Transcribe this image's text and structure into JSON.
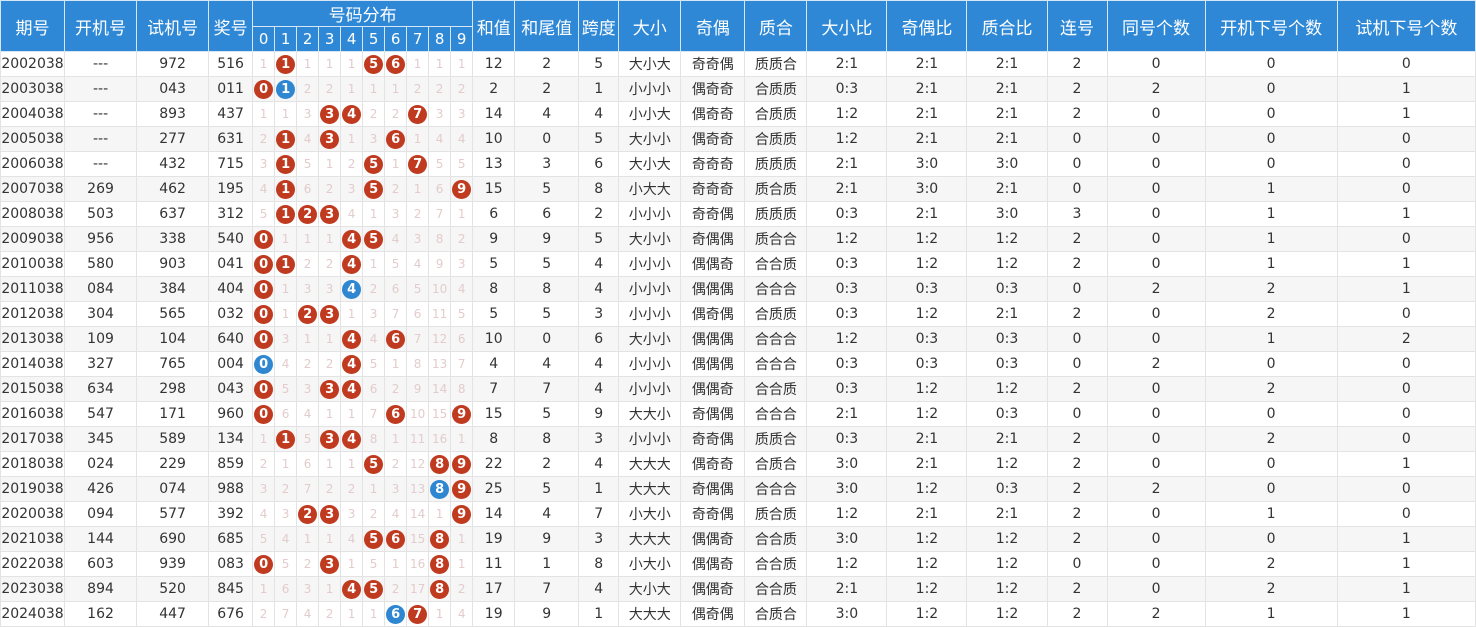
{
  "headers": {
    "period": "期号",
    "open_no": "开机号",
    "test_no": "试机号",
    "prize_no": "奖号",
    "distribution": "号码分布",
    "digits": [
      "0",
      "1",
      "2",
      "3",
      "4",
      "5",
      "6",
      "7",
      "8",
      "9"
    ],
    "sum": "和值",
    "sum_tail": "和尾值",
    "span": "跨度",
    "size": "大小",
    "parity": "奇偶",
    "prime": "质合",
    "size_ratio": "大小比",
    "parity_ratio": "奇偶比",
    "prime_ratio": "质合比",
    "consec": "连号",
    "same_cnt": "同号个数",
    "open_down_cnt": "开机下号个数",
    "test_down_cnt": "试机下号个数"
  },
  "colors": {
    "header_bg": "#2e88d6",
    "ball_red": "#bf3a1f",
    "ball_blue": "#2f87d1",
    "omit_text": "#e3cccc"
  },
  "rows": [
    {
      "period": "2002038",
      "open": "---",
      "test": "972",
      "prize": "516",
      "dist": [
        "1",
        "1",
        "1",
        "1",
        "1",
        "5",
        "6",
        "1",
        "1",
        "1"
      ],
      "balls": {
        "1": "r",
        "5": "r",
        "6": "r"
      },
      "sum": "12",
      "tail": "2",
      "span": "5",
      "size": "大小大",
      "parity": "奇奇偶",
      "prime": "质质合",
      "sr": "2:1",
      "pr": "2:1",
      "qr": "2:1",
      "consec": "2",
      "same": "0",
      "od": "0",
      "td": "0"
    },
    {
      "period": "2003038",
      "open": "---",
      "test": "043",
      "prize": "011",
      "dist": [
        "0",
        "1",
        "2",
        "2",
        "1",
        "1",
        "1",
        "2",
        "2",
        "2"
      ],
      "balls": {
        "0": "r",
        "1": "b"
      },
      "sum": "2",
      "tail": "2",
      "span": "1",
      "size": "小小小",
      "parity": "偶奇奇",
      "prime": "合质质",
      "sr": "0:3",
      "pr": "2:1",
      "qr": "2:1",
      "consec": "2",
      "same": "2",
      "od": "0",
      "td": "1"
    },
    {
      "period": "2004038",
      "open": "---",
      "test": "893",
      "prize": "437",
      "dist": [
        "1",
        "1",
        "3",
        "3",
        "4",
        "2",
        "2",
        "7",
        "3",
        "3"
      ],
      "balls": {
        "3": "r",
        "4": "r",
        "7": "r"
      },
      "sum": "14",
      "tail": "4",
      "span": "4",
      "size": "小小大",
      "parity": "偶奇奇",
      "prime": "合质质",
      "sr": "1:2",
      "pr": "2:1",
      "qr": "2:1",
      "consec": "2",
      "same": "0",
      "od": "0",
      "td": "1"
    },
    {
      "period": "2005038",
      "open": "---",
      "test": "277",
      "prize": "631",
      "dist": [
        "2",
        "1",
        "4",
        "3",
        "1",
        "3",
        "6",
        "1",
        "4",
        "4"
      ],
      "balls": {
        "1": "r",
        "3": "r",
        "6": "r"
      },
      "sum": "10",
      "tail": "0",
      "span": "5",
      "size": "大小小",
      "parity": "偶奇奇",
      "prime": "合质质",
      "sr": "1:2",
      "pr": "2:1",
      "qr": "2:1",
      "consec": "0",
      "same": "0",
      "od": "0",
      "td": "0"
    },
    {
      "period": "2006038",
      "open": "---",
      "test": "432",
      "prize": "715",
      "dist": [
        "3",
        "1",
        "5",
        "1",
        "2",
        "5",
        "1",
        "7",
        "5",
        "5"
      ],
      "balls": {
        "1": "r",
        "5": "r",
        "7": "r"
      },
      "sum": "13",
      "tail": "3",
      "span": "6",
      "size": "大小大",
      "parity": "奇奇奇",
      "prime": "质质质",
      "sr": "2:1",
      "pr": "3:0",
      "qr": "3:0",
      "consec": "0",
      "same": "0",
      "od": "0",
      "td": "0"
    },
    {
      "period": "2007038",
      "open": "269",
      "test": "462",
      "prize": "195",
      "dist": [
        "4",
        "1",
        "6",
        "2",
        "3",
        "5",
        "2",
        "1",
        "6",
        "9"
      ],
      "balls": {
        "1": "r",
        "5": "r",
        "9": "r"
      },
      "sum": "15",
      "tail": "5",
      "span": "8",
      "size": "小大大",
      "parity": "奇奇奇",
      "prime": "质合质",
      "sr": "2:1",
      "pr": "3:0",
      "qr": "2:1",
      "consec": "0",
      "same": "0",
      "od": "1",
      "td": "0"
    },
    {
      "period": "2008038",
      "open": "503",
      "test": "637",
      "prize": "312",
      "dist": [
        "5",
        "1",
        "2",
        "3",
        "4",
        "1",
        "3",
        "2",
        "7",
        "1"
      ],
      "balls": {
        "1": "r",
        "2": "r",
        "3": "r"
      },
      "sum": "6",
      "tail": "6",
      "span": "2",
      "size": "小小小",
      "parity": "奇奇偶",
      "prime": "质质质",
      "sr": "0:3",
      "pr": "2:1",
      "qr": "3:0",
      "consec": "3",
      "same": "0",
      "od": "1",
      "td": "1"
    },
    {
      "period": "2009038",
      "open": "956",
      "test": "338",
      "prize": "540",
      "dist": [
        "0",
        "1",
        "1",
        "1",
        "4",
        "5",
        "4",
        "3",
        "8",
        "2"
      ],
      "balls": {
        "0": "r",
        "4": "r",
        "5": "r"
      },
      "sum": "9",
      "tail": "9",
      "span": "5",
      "size": "大小小",
      "parity": "奇偶偶",
      "prime": "质合合",
      "sr": "1:2",
      "pr": "1:2",
      "qr": "1:2",
      "consec": "2",
      "same": "0",
      "od": "1",
      "td": "0"
    },
    {
      "period": "2010038",
      "open": "580",
      "test": "903",
      "prize": "041",
      "dist": [
        "0",
        "1",
        "2",
        "2",
        "4",
        "1",
        "5",
        "4",
        "9",
        "3"
      ],
      "balls": {
        "0": "r",
        "1": "r",
        "4": "r"
      },
      "sum": "5",
      "tail": "5",
      "span": "4",
      "size": "小小小",
      "parity": "偶偶奇",
      "prime": "合合质",
      "sr": "0:3",
      "pr": "1:2",
      "qr": "1:2",
      "consec": "2",
      "same": "0",
      "od": "1",
      "td": "1"
    },
    {
      "period": "2011038",
      "open": "084",
      "test": "384",
      "prize": "404",
      "dist": [
        "0",
        "1",
        "3",
        "3",
        "4",
        "2",
        "6",
        "5",
        "10",
        "4"
      ],
      "balls": {
        "0": "r",
        "4": "b"
      },
      "sum": "8",
      "tail": "8",
      "span": "4",
      "size": "小小小",
      "parity": "偶偶偶",
      "prime": "合合合",
      "sr": "0:3",
      "pr": "0:3",
      "qr": "0:3",
      "consec": "0",
      "same": "2",
      "od": "2",
      "td": "1"
    },
    {
      "period": "2012038",
      "open": "304",
      "test": "565",
      "prize": "032",
      "dist": [
        "0",
        "1",
        "2",
        "3",
        "1",
        "3",
        "7",
        "6",
        "11",
        "5"
      ],
      "balls": {
        "0": "r",
        "2": "r",
        "3": "r"
      },
      "sum": "5",
      "tail": "5",
      "span": "3",
      "size": "小小小",
      "parity": "偶奇偶",
      "prime": "合质质",
      "sr": "0:3",
      "pr": "1:2",
      "qr": "2:1",
      "consec": "2",
      "same": "0",
      "od": "2",
      "td": "0"
    },
    {
      "period": "2013038",
      "open": "109",
      "test": "104",
      "prize": "640",
      "dist": [
        "0",
        "3",
        "1",
        "1",
        "4",
        "4",
        "6",
        "7",
        "12",
        "6"
      ],
      "balls": {
        "0": "r",
        "4": "r",
        "6": "r"
      },
      "sum": "10",
      "tail": "0",
      "span": "6",
      "size": "大小小",
      "parity": "偶偶偶",
      "prime": "合合合",
      "sr": "1:2",
      "pr": "0:3",
      "qr": "0:3",
      "consec": "0",
      "same": "0",
      "od": "1",
      "td": "2"
    },
    {
      "period": "2014038",
      "open": "327",
      "test": "765",
      "prize": "004",
      "dist": [
        "0",
        "4",
        "2",
        "2",
        "4",
        "5",
        "1",
        "8",
        "13",
        "7"
      ],
      "balls": {
        "0": "b",
        "4": "r"
      },
      "sum": "4",
      "tail": "4",
      "span": "4",
      "size": "小小小",
      "parity": "偶偶偶",
      "prime": "合合合",
      "sr": "0:3",
      "pr": "0:3",
      "qr": "0:3",
      "consec": "0",
      "same": "2",
      "od": "0",
      "td": "0"
    },
    {
      "period": "2015038",
      "open": "634",
      "test": "298",
      "prize": "043",
      "dist": [
        "0",
        "5",
        "3",
        "3",
        "4",
        "6",
        "2",
        "9",
        "14",
        "8"
      ],
      "balls": {
        "0": "r",
        "3": "r",
        "4": "r"
      },
      "sum": "7",
      "tail": "7",
      "span": "4",
      "size": "小小小",
      "parity": "偶偶奇",
      "prime": "合合质",
      "sr": "0:3",
      "pr": "1:2",
      "qr": "1:2",
      "consec": "2",
      "same": "0",
      "od": "2",
      "td": "0"
    },
    {
      "period": "2016038",
      "open": "547",
      "test": "171",
      "prize": "960",
      "dist": [
        "0",
        "6",
        "4",
        "1",
        "1",
        "7",
        "6",
        "10",
        "15",
        "9"
      ],
      "balls": {
        "0": "r",
        "6": "r",
        "9": "r"
      },
      "sum": "15",
      "tail": "5",
      "span": "9",
      "size": "大大小",
      "parity": "奇偶偶",
      "prime": "合合合",
      "sr": "2:1",
      "pr": "1:2",
      "qr": "0:3",
      "consec": "0",
      "same": "0",
      "od": "0",
      "td": "0"
    },
    {
      "period": "2017038",
      "open": "345",
      "test": "589",
      "prize": "134",
      "dist": [
        "1",
        "1",
        "5",
        "3",
        "4",
        "8",
        "1",
        "11",
        "16",
        "1"
      ],
      "balls": {
        "1": "r",
        "3": "r",
        "4": "r"
      },
      "sum": "8",
      "tail": "8",
      "span": "3",
      "size": "小小小",
      "parity": "奇奇偶",
      "prime": "质质合",
      "sr": "0:3",
      "pr": "2:1",
      "qr": "2:1",
      "consec": "2",
      "same": "0",
      "od": "2",
      "td": "0"
    },
    {
      "period": "2018038",
      "open": "024",
      "test": "229",
      "prize": "859",
      "dist": [
        "2",
        "1",
        "6",
        "1",
        "1",
        "5",
        "2",
        "12",
        "8",
        "9"
      ],
      "balls": {
        "5": "r",
        "8": "r",
        "9": "r"
      },
      "sum": "22",
      "tail": "2",
      "span": "4",
      "size": "大大大",
      "parity": "偶奇奇",
      "prime": "合质合",
      "sr": "3:0",
      "pr": "2:1",
      "qr": "1:2",
      "consec": "2",
      "same": "0",
      "od": "0",
      "td": "1"
    },
    {
      "period": "2019038",
      "open": "426",
      "test": "074",
      "prize": "988",
      "dist": [
        "3",
        "2",
        "7",
        "2",
        "2",
        "1",
        "3",
        "13",
        "8",
        "9"
      ],
      "balls": {
        "8": "b",
        "9": "r"
      },
      "sum": "25",
      "tail": "5",
      "span": "1",
      "size": "大大大",
      "parity": "奇偶偶",
      "prime": "合合合",
      "sr": "3:0",
      "pr": "1:2",
      "qr": "0:3",
      "consec": "2",
      "same": "2",
      "od": "0",
      "td": "0"
    },
    {
      "period": "2020038",
      "open": "094",
      "test": "577",
      "prize": "392",
      "dist": [
        "4",
        "3",
        "2",
        "3",
        "3",
        "2",
        "4",
        "14",
        "1",
        "9"
      ],
      "balls": {
        "2": "r",
        "3": "r",
        "9": "r"
      },
      "sum": "14",
      "tail": "4",
      "span": "7",
      "size": "小大小",
      "parity": "奇奇偶",
      "prime": "质合质",
      "sr": "1:2",
      "pr": "2:1",
      "qr": "2:1",
      "consec": "2",
      "same": "0",
      "od": "1",
      "td": "0"
    },
    {
      "period": "2021038",
      "open": "144",
      "test": "690",
      "prize": "685",
      "dist": [
        "5",
        "4",
        "1",
        "1",
        "4",
        "5",
        "6",
        "15",
        "8",
        "1"
      ],
      "balls": {
        "5": "r",
        "6": "r",
        "8": "r"
      },
      "sum": "19",
      "tail": "9",
      "span": "3",
      "size": "大大大",
      "parity": "偶偶奇",
      "prime": "合合质",
      "sr": "3:0",
      "pr": "1:2",
      "qr": "1:2",
      "consec": "2",
      "same": "0",
      "od": "0",
      "td": "1"
    },
    {
      "period": "2022038",
      "open": "603",
      "test": "939",
      "prize": "083",
      "dist": [
        "0",
        "5",
        "2",
        "3",
        "1",
        "5",
        "1",
        "16",
        "8",
        "1"
      ],
      "balls": {
        "0": "r",
        "3": "r",
        "8": "r"
      },
      "sum": "11",
      "tail": "1",
      "span": "8",
      "size": "小大小",
      "parity": "偶偶奇",
      "prime": "合合质",
      "sr": "1:2",
      "pr": "1:2",
      "qr": "1:2",
      "consec": "0",
      "same": "0",
      "od": "2",
      "td": "1"
    },
    {
      "period": "2023038",
      "open": "894",
      "test": "520",
      "prize": "845",
      "dist": [
        "1",
        "6",
        "3",
        "1",
        "4",
        "5",
        "2",
        "17",
        "8",
        "2"
      ],
      "balls": {
        "4": "r",
        "5": "r",
        "8": "r"
      },
      "sum": "17",
      "tail": "7",
      "span": "4",
      "size": "大小大",
      "parity": "偶偶奇",
      "prime": "合合质",
      "sr": "2:1",
      "pr": "1:2",
      "qr": "1:2",
      "consec": "2",
      "same": "0",
      "od": "2",
      "td": "1"
    },
    {
      "period": "2024038",
      "open": "162",
      "test": "447",
      "prize": "676",
      "dist": [
        "2",
        "7",
        "4",
        "2",
        "1",
        "1",
        "6",
        "7",
        "1",
        "4"
      ],
      "balls": {
        "6": "b",
        "7": "r"
      },
      "sum": "19",
      "tail": "9",
      "span": "1",
      "size": "大大大",
      "parity": "偶奇偶",
      "prime": "合质合",
      "sr": "3:0",
      "pr": "1:2",
      "qr": "1:2",
      "consec": "2",
      "same": "2",
      "od": "1",
      "td": "1"
    }
  ]
}
